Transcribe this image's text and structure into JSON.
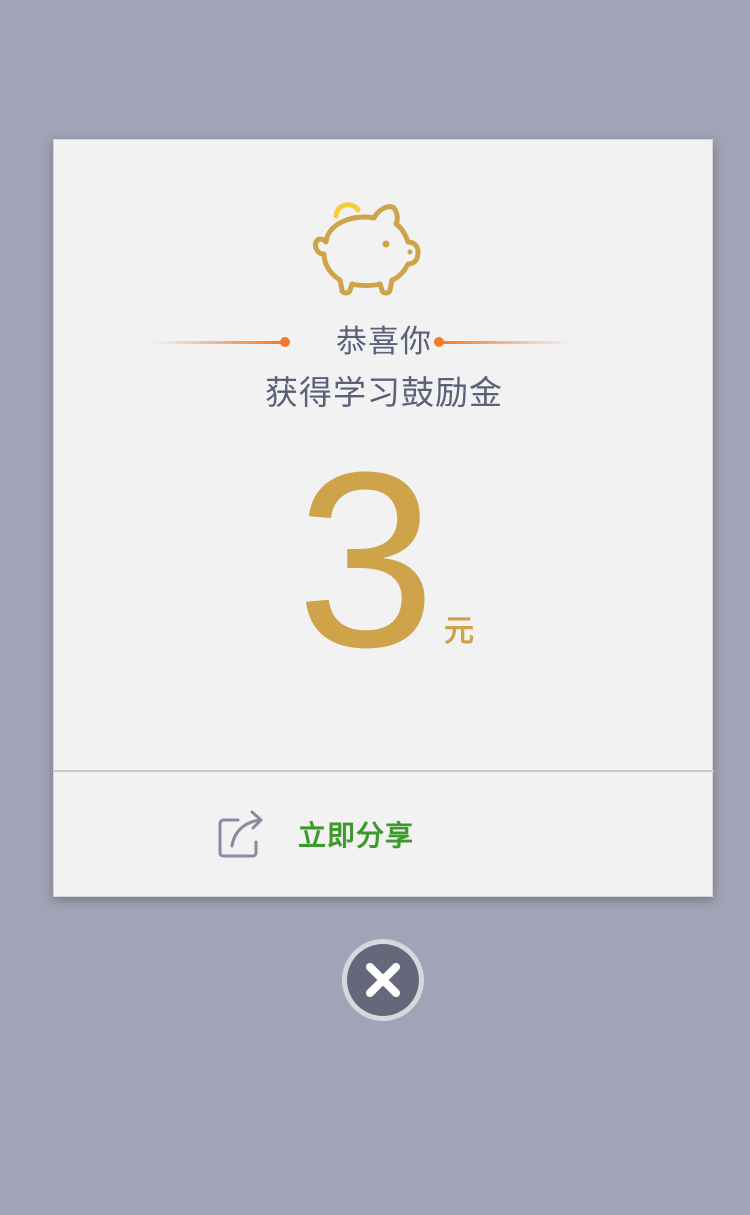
{
  "dialog": {
    "icon": "piggy-bank-icon",
    "congrats": "恭喜你",
    "subtitle": "获得学习鼓励金",
    "amount": "3",
    "unit": "元",
    "share": {
      "icon": "share-icon",
      "label": "立即分享"
    },
    "close_icon": "close-icon"
  },
  "colors": {
    "background": "#a0a4b6",
    "card": "#f2f2f2",
    "gold": "#cfa34a",
    "accent_orange": "#f27a28",
    "text": "#5a6078",
    "share_green": "#3c9a2c"
  }
}
